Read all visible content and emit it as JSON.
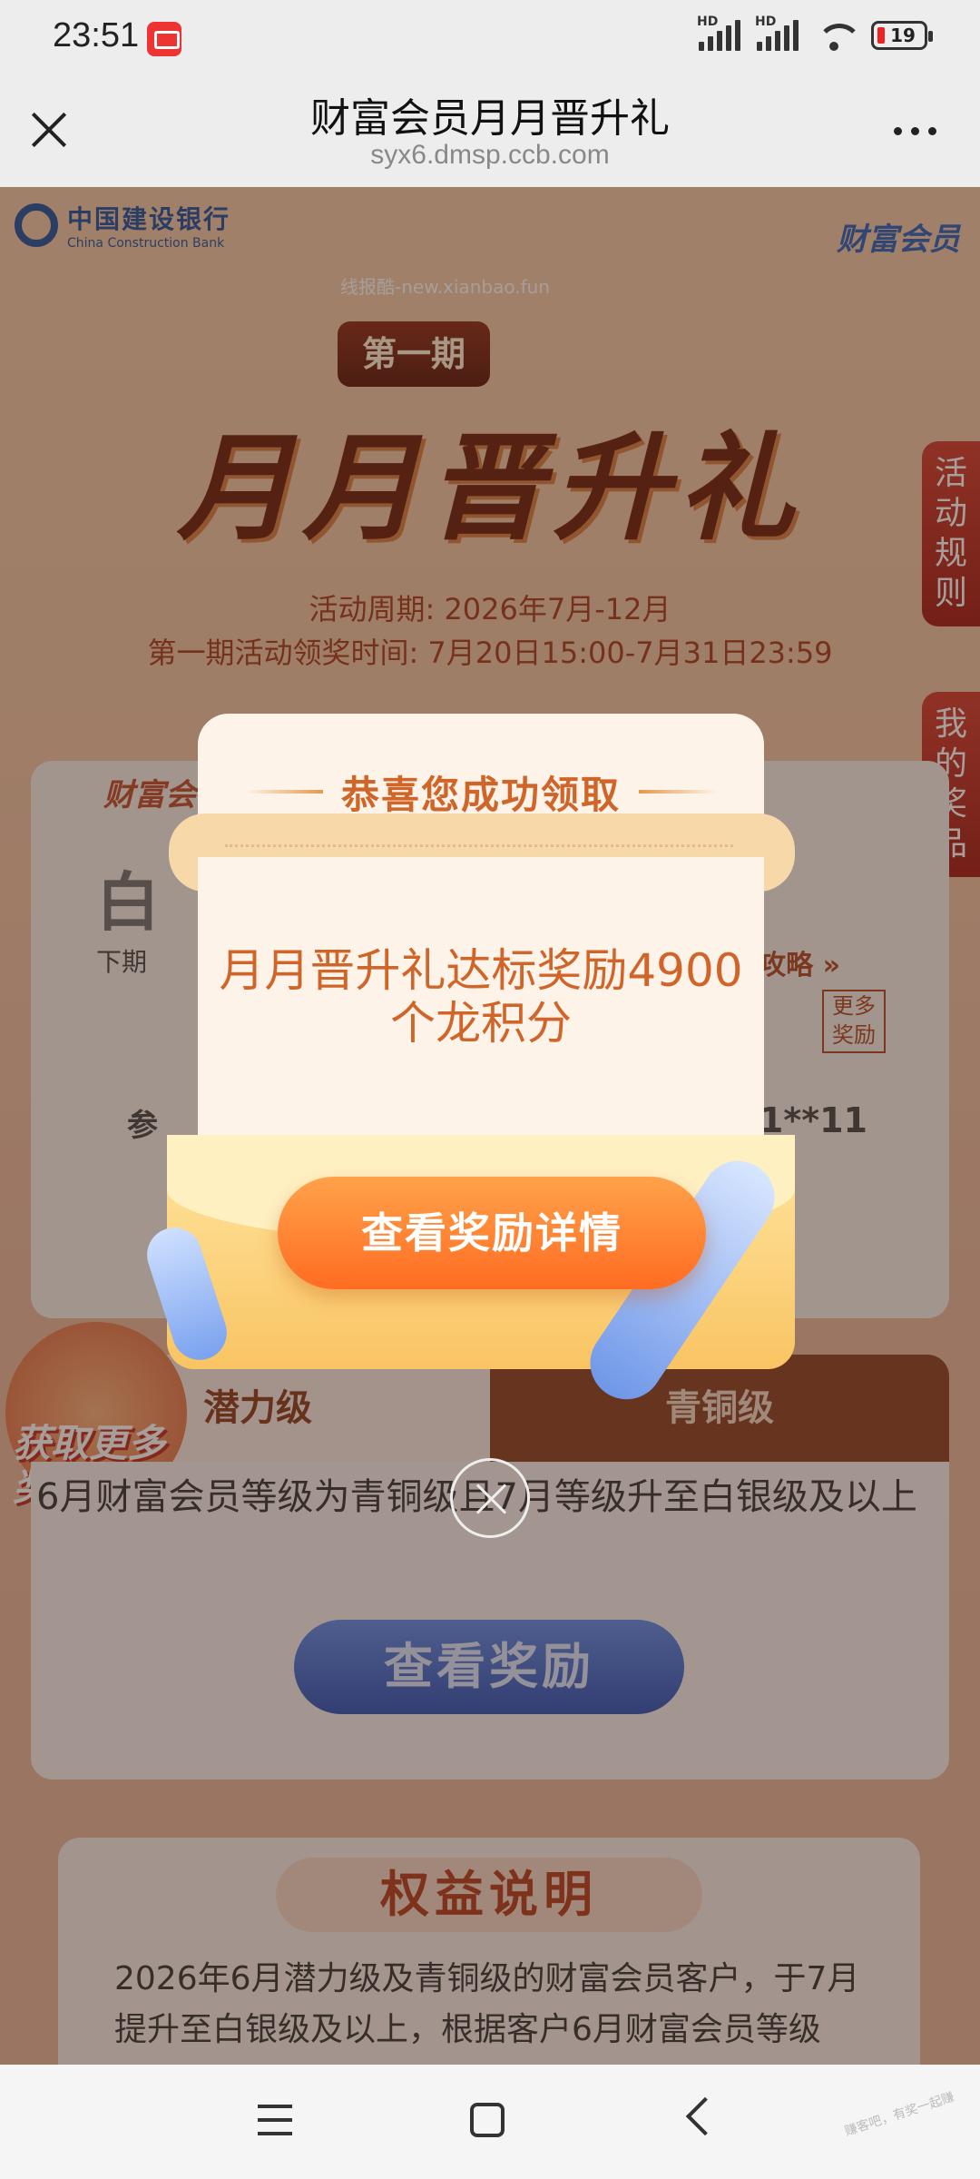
{
  "status_bar": {
    "time": "23:51",
    "battery": "19",
    "signal_label": "HD"
  },
  "browser": {
    "title": "财富会员月月晋升礼",
    "url": "syx6.dmsp.ccb.com"
  },
  "page": {
    "bank_name": "中国建设银行",
    "bank_name_en": "China Construction Bank",
    "vip_logo": "财富会员",
    "watermark": "线报酷-new.xianbao.fun",
    "issue_tag": "第一期",
    "main_title": "月月晋升礼",
    "period": "活动周期: 2026年7月-12月",
    "claim_time": "第一期活动领奖时间: 7月20日15:00-7月31日23:59",
    "side_tabs": [
      "活动规则",
      "我的奖品"
    ],
    "member_card": {
      "brand": "财富会",
      "level": "白",
      "next_label": "下期",
      "strategy": "攻略 »",
      "more_rewards": "更多奖励",
      "participant": "参",
      "phone": "11**11"
    },
    "tabs": [
      "潜力级",
      "青铜级"
    ],
    "gift_text": "获取更多奖励",
    "tab_desc": "6月财富会员等级为青铜级且7月等级升至白银级及以上",
    "view_reward": "查看奖励",
    "rights_title": "权益说明",
    "rights_text": "2026年6月潜力级及青铜级的财富会员客户，于7月提升至白银级及以上，根据客户6月财富会员等级"
  },
  "modal": {
    "heading": "恭喜您成功领取",
    "message": "月月晋升礼达标奖励4900个龙积分",
    "button": "查看奖励详情"
  },
  "nav": {
    "corner_watermark": "赚客吧，有奖一起赚"
  },
  "colors": {
    "accent_orange": "#ff6c22",
    "heading_orange": "#d0652a",
    "ccb_blue": "#1f4f9b",
    "side_tab_red": "#c22a1e"
  }
}
